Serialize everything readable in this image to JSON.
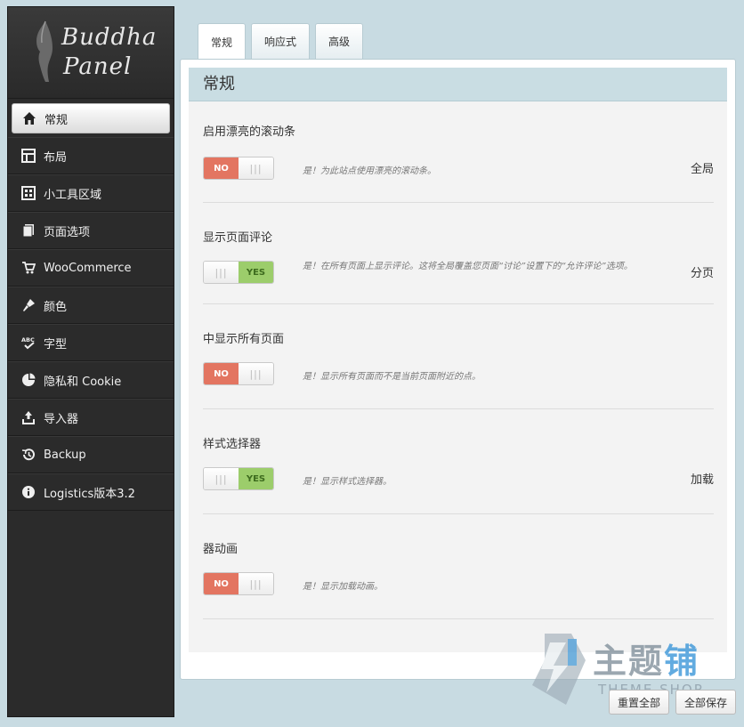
{
  "logo": {
    "line1": "Buddha",
    "line2": "Panel"
  },
  "sidebar": {
    "items": [
      {
        "label": "常规",
        "icon": "home-icon",
        "active": true
      },
      {
        "label": "布局",
        "icon": "layout-icon"
      },
      {
        "label": "小工具区域",
        "icon": "widgets-icon"
      },
      {
        "label": "页面选项",
        "icon": "pages-icon"
      },
      {
        "label": "WooCommerce",
        "icon": "cart-icon"
      },
      {
        "label": "颜色",
        "icon": "paint-icon"
      },
      {
        "label": "字型",
        "icon": "spellcheck-icon"
      },
      {
        "label": "隐私和 Cookie",
        "icon": "pie-icon"
      },
      {
        "label": "导入器",
        "icon": "upload-icon"
      },
      {
        "label": "Backup",
        "icon": "history-icon"
      },
      {
        "label": "Logistics版本3.2",
        "icon": "info-icon"
      }
    ]
  },
  "tabs": [
    {
      "label": "常规",
      "active": true
    },
    {
      "label": "响应式"
    },
    {
      "label": "高级"
    }
  ],
  "section": {
    "title": "常规"
  },
  "options": [
    {
      "title": "启用漂亮的滚动条",
      "state": "NO",
      "desc": "是！为此站点使用漂亮的滚动条。",
      "right": "全局"
    },
    {
      "title": "显示页面评论",
      "state": "YES",
      "desc": "是！在所有页面上显示评论。这将全局覆盖您页面“讨论”设置下的“允许评论”选项。",
      "right": "分页"
    },
    {
      "title": "中显示所有页面",
      "state": "NO",
      "desc": "是！显示所有页面而不是当前页面附近的点。",
      "right": ""
    },
    {
      "title": "样式选择器",
      "state": "YES",
      "desc": "是！显示样式选择器。",
      "right": "加载"
    },
    {
      "title": "器动画",
      "state": "NO",
      "desc": "是！显示加载动画。",
      "right": ""
    }
  ],
  "toggle_labels": {
    "no": "NO",
    "yes": "YES",
    "grip": "|||"
  },
  "buttons": {
    "reset": "重置全部",
    "save": "全部保存"
  },
  "watermark": {
    "main": "主题",
    "accent": "铺",
    "sub": "THEME SHOP"
  },
  "colors": {
    "no": "#e37561",
    "yes": "#9ccd6b",
    "header": "#c9dde3",
    "sidebar": "#2b2b2b"
  }
}
